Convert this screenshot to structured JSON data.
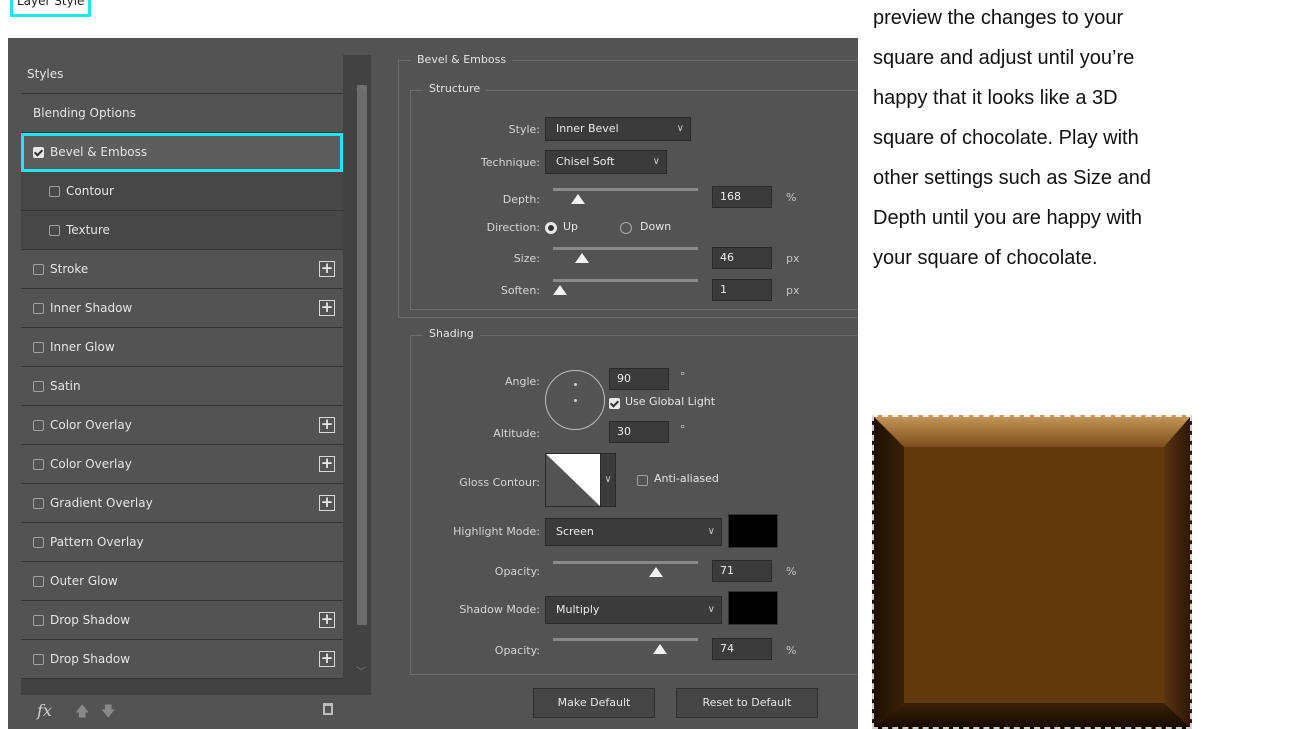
{
  "caption": "Layer Style",
  "left_panel": {
    "header": "Styles",
    "items": [
      {
        "label": "Blending Options",
        "check": false,
        "checkbox": false,
        "indent": false,
        "plus": false,
        "selected": false
      },
      {
        "label": "Bevel & Emboss",
        "check": true,
        "checkbox": true,
        "indent": false,
        "plus": false,
        "selected": true
      },
      {
        "label": "Contour",
        "check": false,
        "checkbox": true,
        "indent": true,
        "plus": false,
        "selected": false
      },
      {
        "label": "Texture",
        "check": false,
        "checkbox": true,
        "indent": true,
        "plus": false,
        "selected": false
      },
      {
        "label": "Stroke",
        "check": false,
        "checkbox": true,
        "indent": false,
        "plus": true,
        "selected": false
      },
      {
        "label": "Inner Shadow",
        "check": false,
        "checkbox": true,
        "indent": false,
        "plus": true,
        "selected": false
      },
      {
        "label": "Inner Glow",
        "check": false,
        "checkbox": true,
        "indent": false,
        "plus": false,
        "selected": false
      },
      {
        "label": "Satin",
        "check": false,
        "checkbox": true,
        "indent": false,
        "plus": false,
        "selected": false
      },
      {
        "label": "Color Overlay",
        "check": false,
        "checkbox": true,
        "indent": false,
        "plus": true,
        "selected": false
      },
      {
        "label": "Color Overlay",
        "check": false,
        "checkbox": true,
        "indent": false,
        "plus": true,
        "selected": false
      },
      {
        "label": "Gradient Overlay",
        "check": false,
        "checkbox": true,
        "indent": false,
        "plus": true,
        "selected": false
      },
      {
        "label": "Pattern Overlay",
        "check": false,
        "checkbox": true,
        "indent": false,
        "plus": false,
        "selected": false
      },
      {
        "label": "Outer Glow",
        "check": false,
        "checkbox": true,
        "indent": false,
        "plus": false,
        "selected": false
      },
      {
        "label": "Drop Shadow",
        "check": false,
        "checkbox": true,
        "indent": false,
        "plus": true,
        "selected": false
      },
      {
        "label": "Drop Shadow",
        "check": false,
        "checkbox": true,
        "indent": false,
        "plus": true,
        "selected": false
      }
    ],
    "fx_label": "fx"
  },
  "bevel": {
    "group_title": "Bevel & Emboss",
    "structure_title": "Structure",
    "style_label": "Style:",
    "style_value": "Inner Bevel",
    "technique_label": "Technique:",
    "technique_value": "Chisel Soft",
    "depth_label": "Depth:",
    "depth_value": "168",
    "depth_unit": "%",
    "direction_label": "Direction:",
    "direction_up": "Up",
    "direction_down": "Down",
    "size_label": "Size:",
    "size_value": "46",
    "size_unit": "px",
    "soften_label": "Soften:",
    "soften_value": "1",
    "soften_unit": "px"
  },
  "shading": {
    "title": "Shading",
    "angle_label": "Angle:",
    "angle_value": "90",
    "angle_unit": "°",
    "use_global_light": "Use Global Light",
    "altitude_label": "Altitude:",
    "altitude_value": "30",
    "altitude_unit": "°",
    "gloss_label": "Gloss Contour:",
    "anti_aliased": "Anti-aliased",
    "highlight_label": "Highlight Mode:",
    "highlight_value": "Screen",
    "highlight_color": "#000000",
    "opacity_label": "Opacity:",
    "highlight_opacity": "71",
    "opacity_unit": "%",
    "shadow_label": "Shadow Mode:",
    "shadow_value": "Multiply",
    "shadow_color": "#000000",
    "shadow_opacity": "74"
  },
  "buttons": {
    "make_default": "Make Default",
    "reset_default": "Reset to Default"
  },
  "paragraph": [
    "preview the changes to your",
    "square and adjust until you’re",
    "happy that it looks like a 3D",
    "square of chocolate. Play with",
    "other settings such as Size and",
    "Depth until you are happy with",
    "your square of chocolate."
  ],
  "sliders": {
    "depth": 0.17,
    "size": 0.2,
    "soften": 0.05,
    "highlight_opacity": 0.71,
    "shadow_opacity": 0.74
  }
}
